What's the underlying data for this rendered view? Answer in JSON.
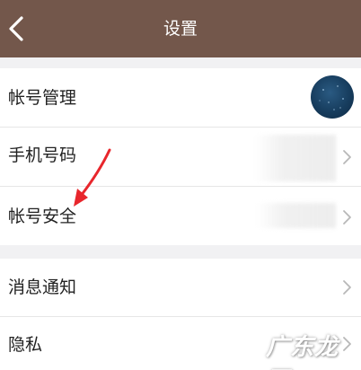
{
  "header": {
    "title": "设置"
  },
  "group1": {
    "items": [
      {
        "label": "帐号管理"
      },
      {
        "label": "手机号码"
      },
      {
        "label": "帐号安全"
      }
    ]
  },
  "group2": {
    "items": [
      {
        "label": "消息通知"
      },
      {
        "label": "隐私"
      }
    ]
  },
  "watermark": {
    "text": "广东龙网"
  },
  "colors": {
    "header_bg": "#73574b",
    "annotation_arrow": "#e8262c"
  }
}
